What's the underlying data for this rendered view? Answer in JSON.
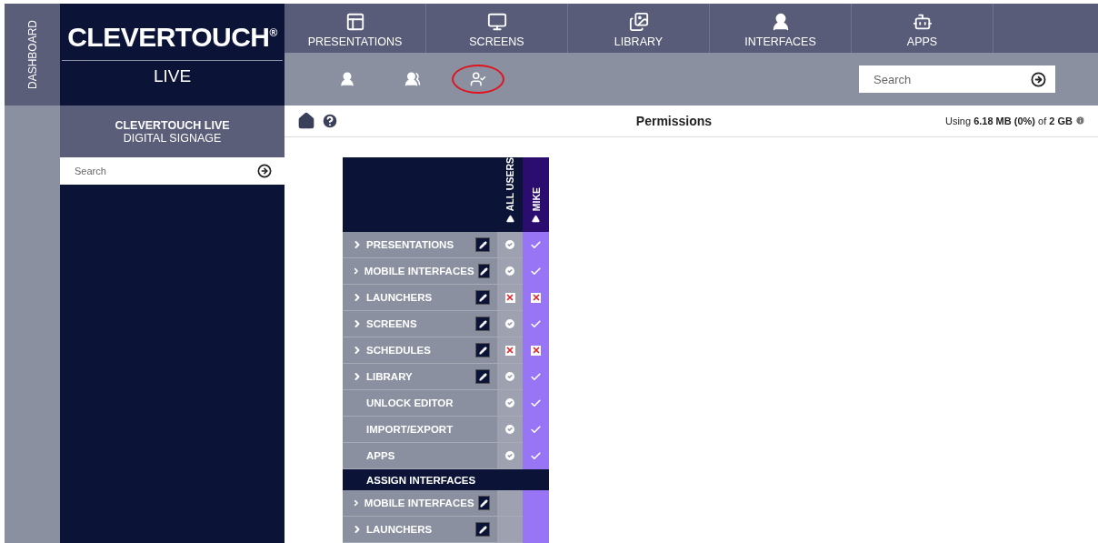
{
  "sidebar_tab": {
    "label": "DASHBOARD"
  },
  "logo": {
    "name": "CLEVERTOUCH",
    "mark": "®",
    "subtitle": "LIVE"
  },
  "nav_tabs": [
    {
      "label": "PRESENTATIONS",
      "kind": "presentations",
      "selected": false
    },
    {
      "label": "SCREENS",
      "kind": "screens",
      "selected": false
    },
    {
      "label": "LIBRARY",
      "kind": "library",
      "selected": false
    },
    {
      "label": "INTERFACES",
      "kind": "interfaces",
      "selected": false
    },
    {
      "label": "APPS",
      "kind": "apps",
      "selected": false
    }
  ],
  "subnav": [
    {
      "kind": "users",
      "circled": false
    },
    {
      "kind": "groups",
      "circled": false
    },
    {
      "kind": "permissions",
      "circled": true
    }
  ],
  "top_search": {
    "placeholder": "Search"
  },
  "sidebar": {
    "title": "CLEVERTOUCH LIVE",
    "subtitle": "DIGITAL SIGNAGE",
    "search": {
      "placeholder": "Search"
    }
  },
  "toolbar": {
    "title": "Permissions",
    "usage": "Using **6.18 MB (0%)** of **2 GB**"
  },
  "permissions": {
    "columns": [
      {
        "label": "ALL USERS",
        "kind": "all"
      },
      {
        "label": "MIKE",
        "kind": "user"
      }
    ],
    "rows": [
      {
        "kind": "permission",
        "label": "PRESENTATIONS",
        "expandable": true,
        "editable": true,
        "access": [
          true,
          true
        ]
      },
      {
        "kind": "permission",
        "label": "MOBILE INTERFACES",
        "expandable": true,
        "editable": true,
        "access": [
          true,
          true
        ]
      },
      {
        "kind": "permission",
        "label": "LAUNCHERS",
        "expandable": true,
        "editable": true,
        "access": [
          false,
          false
        ]
      },
      {
        "kind": "permission",
        "label": "SCREENS",
        "expandable": true,
        "editable": true,
        "access": [
          true,
          true
        ]
      },
      {
        "kind": "permission",
        "label": "SCHEDULES",
        "expandable": true,
        "editable": true,
        "access": [
          false,
          false
        ]
      },
      {
        "kind": "permission",
        "label": "LIBRARY",
        "expandable": true,
        "editable": true,
        "access": [
          true,
          true
        ]
      },
      {
        "kind": "permission",
        "label": "UNLOCK EDITOR",
        "expandable": false,
        "editable": false,
        "access": [
          true,
          true
        ]
      },
      {
        "kind": "permission",
        "label": "IMPORT/EXPORT",
        "expandable": false,
        "editable": false,
        "access": [
          true,
          true
        ]
      },
      {
        "kind": "permission",
        "label": "APPS",
        "expandable": false,
        "editable": false,
        "access": [
          true,
          true
        ]
      },
      {
        "kind": "section",
        "label": "ASSIGN INTERFACES"
      },
      {
        "kind": "permission",
        "label": "MOBILE INTERFACES",
        "expandable": true,
        "editable": true
      },
      {
        "kind": "permission",
        "label": "LAUNCHERS",
        "expandable": true,
        "editable": true
      }
    ]
  }
}
